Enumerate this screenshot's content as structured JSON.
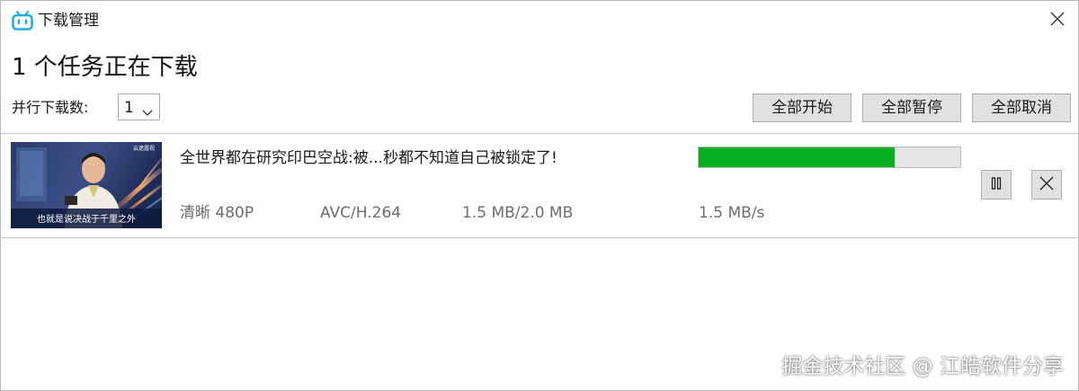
{
  "window": {
    "title": "下载管理",
    "icon": "bilibili-tv-icon",
    "close_icon": "close-icon"
  },
  "header": {
    "status": "1 个任务正在下载",
    "concurrency_label": "并行下载数:",
    "concurrency_value": "1",
    "buttons": {
      "start_all": "全部开始",
      "pause_all": "全部暂停",
      "cancel_all": "全部取消"
    }
  },
  "downloads": [
    {
      "title": "全世界都在研究印巴空战:被...秒都不知道自己被锁定了!",
      "quality": "清晰 480P",
      "codec": "AVC/H.264",
      "size": "1.5 MB/2.0 MB",
      "speed": "1.5 MB/s",
      "progress": 0.75,
      "thumbnail_caption": "也就是说决战于千里之外",
      "thumbnail_logo": "云遮露视",
      "pause_icon": "pause-icon",
      "remove_icon": "close-icon"
    }
  ],
  "colors": {
    "progress_fill": "#06b025",
    "progress_track": "#e6e6e6",
    "button_bg": "#e1e1e1",
    "brand": "#23aee5"
  },
  "watermark": "掘金技术社区 @ 江皓软件分享"
}
